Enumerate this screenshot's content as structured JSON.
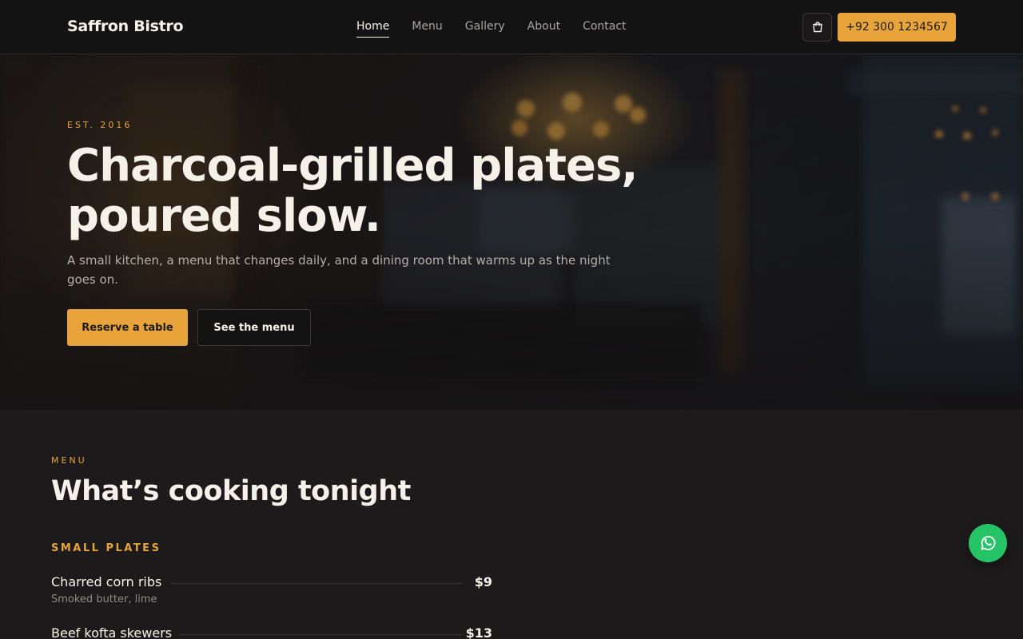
{
  "nav": {
    "brand": "Saffron Bistro",
    "links": [
      {
        "label": "Home",
        "active": true
      },
      {
        "label": "Menu",
        "active": false
      },
      {
        "label": "Gallery",
        "active": false
      },
      {
        "label": "About",
        "active": false
      },
      {
        "label": "Contact",
        "active": false
      }
    ],
    "cart_icon": "cart-icon",
    "phone_label": "+92 300 1234567"
  },
  "hero": {
    "eyebrow": "EST. 2016",
    "title_line1": "Charcoal-grilled plates,",
    "title_line2": "poured slow.",
    "subtitle": "A small kitchen, a menu that changes daily, and a dining room that warms up as the night goes on.",
    "primary_cta": "Reserve a table",
    "secondary_cta": "See the menu"
  },
  "menu": {
    "eyebrow": "MENU",
    "title": "What’s cooking tonight",
    "category": "SMALL PLATES",
    "items": [
      {
        "name": "Charred corn ribs",
        "desc": "Smoked butter, lime",
        "price": "$9"
      },
      {
        "name": "Beef kofta skewers",
        "desc": "",
        "price": "$13"
      }
    ]
  },
  "whatsapp_icon": "whatsapp-icon",
  "colors": {
    "accent": "#e8a43b",
    "background": "#1c1a1b",
    "nav_background": "#141314",
    "whatsapp": "#25c366"
  }
}
